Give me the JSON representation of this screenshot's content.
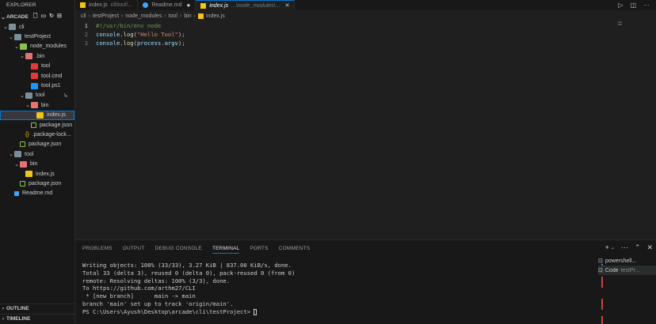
{
  "sidebar": {
    "header": "EXPLORER",
    "root": "ARCADE",
    "tree": [
      {
        "label": "cli",
        "kind": "folder-open",
        "indent": 1,
        "chevron": "⌄"
      },
      {
        "label": "testProject",
        "kind": "folder-open",
        "indent": 2,
        "chevron": "⌄"
      },
      {
        "label": "node_modules",
        "kind": "folder-node",
        "indent": 3,
        "chevron": "⌄"
      },
      {
        "label": ".bin",
        "kind": "folder-bin",
        "indent": 4,
        "chevron": "⌄"
      },
      {
        "label": "tool",
        "kind": "file-red",
        "indent": 5,
        "chevron": ""
      },
      {
        "label": "tool.cmd",
        "kind": "file-red",
        "indent": 5,
        "chevron": ""
      },
      {
        "label": "tool.ps1",
        "kind": "file-ps1",
        "indent": 5,
        "chevron": ""
      },
      {
        "label": "tool",
        "kind": "folder-open",
        "indent": 4,
        "chevron": "⌄"
      },
      {
        "label": "bin",
        "kind": "folder-bin",
        "indent": 5,
        "chevron": "⌄"
      },
      {
        "label": "index.js",
        "kind": "file-js",
        "indent": 6,
        "chevron": "",
        "selected": true
      },
      {
        "label": "package.json",
        "kind": "file-json",
        "indent": 5,
        "chevron": ""
      },
      {
        "label": ".package-lock...",
        "kind": "file-lock",
        "indent": 4,
        "chevron": ""
      },
      {
        "label": "package.json",
        "kind": "file-json",
        "indent": 3,
        "chevron": ""
      },
      {
        "label": "tool",
        "kind": "folder-open",
        "indent": 2,
        "chevron": "⌄"
      },
      {
        "label": "bin",
        "kind": "folder-bin",
        "indent": 3,
        "chevron": "⌄"
      },
      {
        "label": "index.js",
        "kind": "file-js",
        "indent": 4,
        "chevron": ""
      },
      {
        "label": "package.json",
        "kind": "file-json",
        "indent": 3,
        "chevron": ""
      },
      {
        "label": "Readme.md",
        "kind": "file-readme",
        "indent": 2,
        "chevron": ""
      }
    ],
    "outline": "OUTLINE",
    "timeline": "TIMELINE"
  },
  "tabs": [
    {
      "label": "index.js",
      "desc": "cli\\tool\\...",
      "icon": "file-js",
      "state": "normal"
    },
    {
      "label": "Readme.md",
      "desc": "",
      "icon": "file-readme",
      "state": "dirty"
    },
    {
      "label": "index.js",
      "desc": "...\\node_modules\\...",
      "icon": "file-js",
      "state": "active"
    }
  ],
  "breadcrumb": [
    "cli",
    "testProject",
    "node_modules",
    "tool",
    "bin",
    "index.js"
  ],
  "editor": {
    "lines": [
      {
        "n": "1",
        "parts": [
          {
            "t": "#!/usr/bin/env node",
            "c": "tok-comment"
          }
        ]
      },
      {
        "n": "2",
        "parts": [
          {
            "t": "console",
            "c": "tok-obj"
          },
          {
            "t": ".",
            "c": ""
          },
          {
            "t": "log",
            "c": "tok-fn"
          },
          {
            "t": "(",
            "c": ""
          },
          {
            "t": "\"Hello Tool\"",
            "c": "tok-str"
          },
          {
            "t": ");",
            "c": ""
          }
        ]
      },
      {
        "n": "3",
        "parts": [
          {
            "t": "console",
            "c": "tok-obj"
          },
          {
            "t": ".",
            "c": ""
          },
          {
            "t": "log",
            "c": "tok-fn"
          },
          {
            "t": "(",
            "c": ""
          },
          {
            "t": "process",
            "c": "tok-obj"
          },
          {
            "t": ".",
            "c": ""
          },
          {
            "t": "argv",
            "c": "tok-obj"
          },
          {
            "t": ");",
            "c": ""
          }
        ]
      }
    ]
  },
  "panel": {
    "tabs": [
      "PROBLEMS",
      "OUTPUT",
      "DEBUG CONSOLE",
      "TERMINAL",
      "PORTS",
      "COMMENTS"
    ],
    "active_tab": "TERMINAL",
    "terminal_lines": [
      "Writing objects: 100% (33/33), 3.27 KiB | 837.00 KiB/s, done.",
      "Total 33 (delta 3), reused 0 (delta 0), pack-reused 0 (from 0)",
      "remote: Resolving deltas: 100% (3/3), done.",
      "To https://github.com/arthm27/CLI",
      " * [new branch]      main -> main",
      "branch 'main' set up to track 'origin/main'."
    ],
    "prompt": "PS C:\\Users\\Ayush\\Desktop\\arcade\\cli\\testProject> ",
    "terminals": [
      {
        "label": "powershell...",
        "sub": ""
      },
      {
        "label": "Code",
        "sub": "testPr..."
      }
    ]
  }
}
